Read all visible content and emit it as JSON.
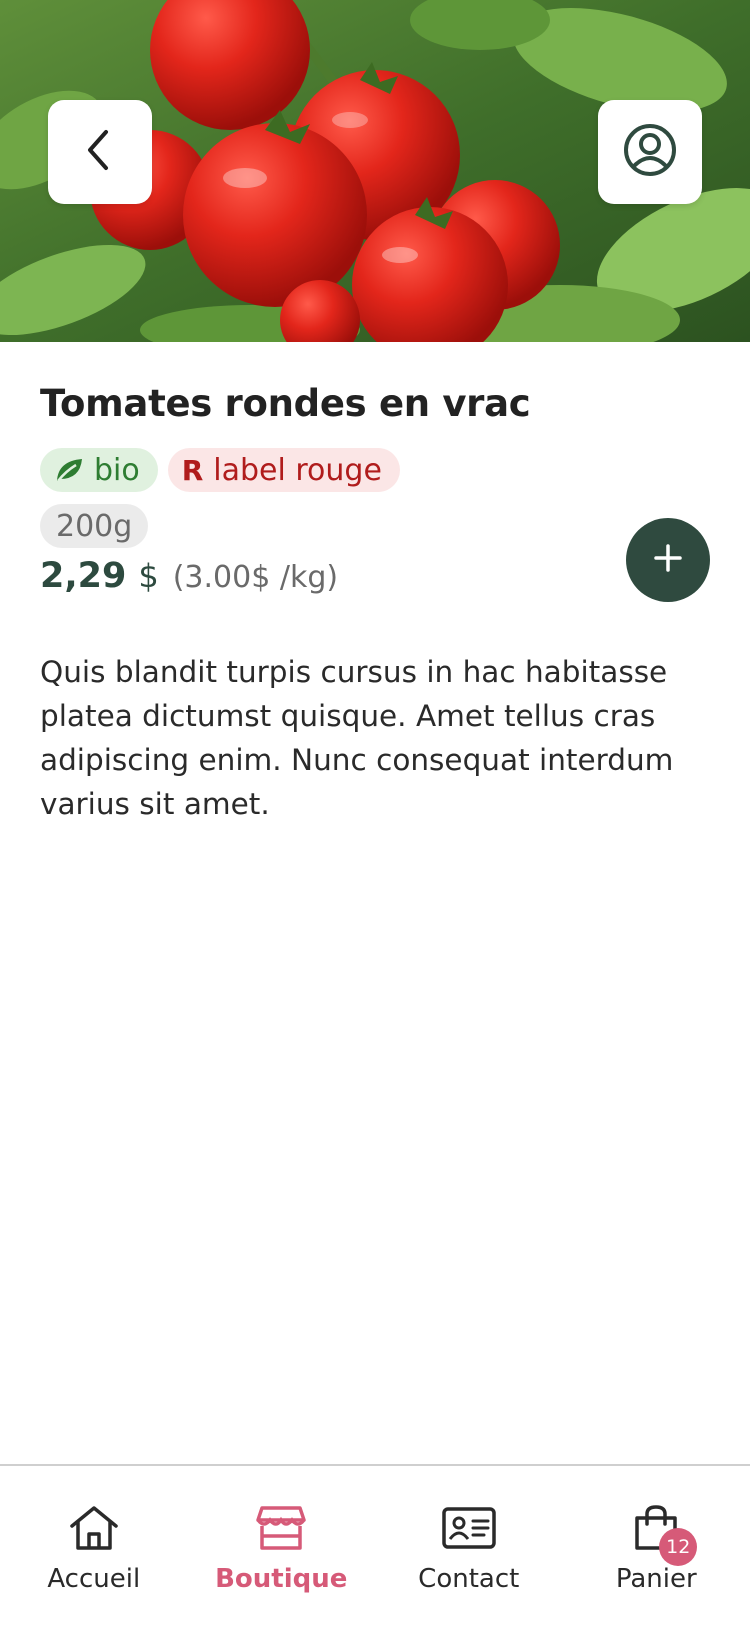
{
  "product": {
    "title": "Tomates rondes en vrac",
    "tags": [
      {
        "label": "bio",
        "icon": "leaf-icon"
      },
      {
        "label": "label rouge",
        "icon_text": "R"
      }
    ],
    "weight": "200g",
    "price": "2,29",
    "currency": "$",
    "unit_price": "(3.00$ /kg)",
    "description": "Quis blandit turpis cursus in hac habitasse platea dictumst quisque. Amet tellus cras adipiscing enim. Nunc consequat interdum varius sit amet."
  },
  "header": {
    "back_icon": "chevron-left-icon",
    "profile_icon": "user-circle-icon"
  },
  "tabbar": {
    "items": [
      {
        "label": "Accueil",
        "icon": "home-icon"
      },
      {
        "label": "Boutique",
        "icon": "shop-icon",
        "active": true
      },
      {
        "label": "Contact",
        "icon": "contact-card-icon"
      },
      {
        "label": "Panier",
        "icon": "shopping-bag-icon",
        "badge": "12"
      }
    ]
  },
  "colors": {
    "accent": "#d65a78",
    "primary_dark": "#2f4a3f",
    "bio_green": "#2e7d32",
    "label_rouge": "#b01c1c"
  }
}
